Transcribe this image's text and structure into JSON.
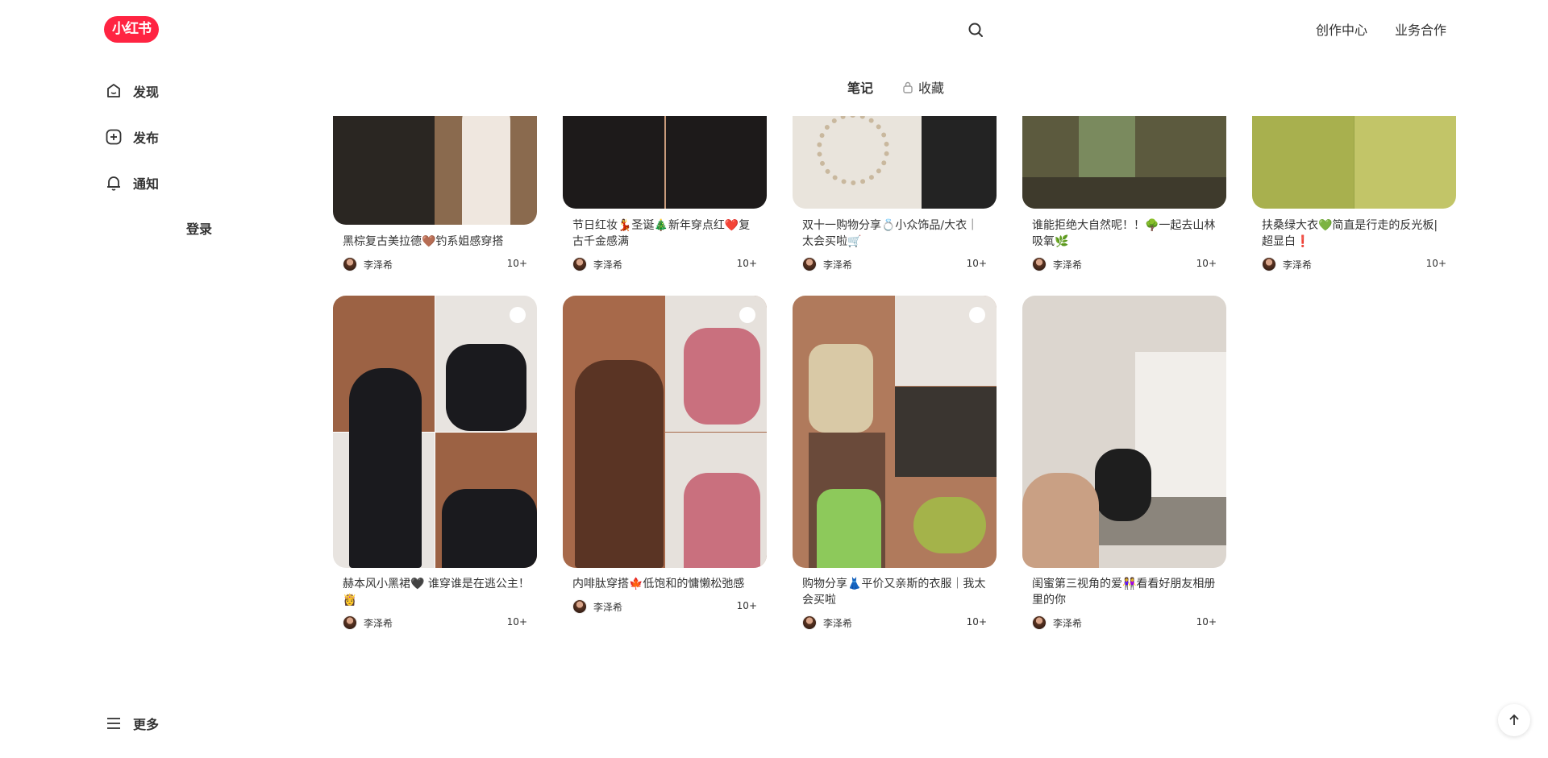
{
  "header": {
    "logo": "小红书",
    "links": [
      "创作中心",
      "业务合作"
    ]
  },
  "sidebar": {
    "items": [
      {
        "label": "发现",
        "icon": "home-icon"
      },
      {
        "label": "发布",
        "icon": "plus-square-icon"
      },
      {
        "label": "通知",
        "icon": "bell-icon"
      }
    ],
    "login": "登录",
    "more": "更多"
  },
  "tabs": [
    {
      "label": "笔记",
      "active": true
    },
    {
      "label": "收藏",
      "active": false,
      "locked": true
    }
  ],
  "notes_row1": [
    {
      "title": "黑棕复古美拉德🤎钓系姐感穿搭",
      "author": "李泽希",
      "likes": "10+",
      "palette": [
        "#2a2622",
        "#efe7df",
        "#8a6a4e"
      ]
    },
    {
      "title": "节日红妆💃圣诞🎄新年穿点红❤️复古千金感满",
      "author": "李泽希",
      "likes": "10+",
      "palette": [
        "#b3202b",
        "#1d1a1a",
        "#c89b7b"
      ]
    },
    {
      "title": "双十一购物分享💍小众饰品/大衣｜太会买啦🛒",
      "author": "李泽希",
      "likes": "10+",
      "palette": [
        "#e9e4dc",
        "#c9b89e",
        "#232323"
      ]
    },
    {
      "title": "谁能拒绝大自然呢！！🌳一起去山林吸氧🌿",
      "author": "李泽希",
      "likes": "10+",
      "palette": [
        "#5c5a3e",
        "#7a8a5e",
        "#3e3a2c"
      ]
    },
    {
      "title": "扶桑绿大衣💚简直是行走的反光板|超显白❗️",
      "author": "李泽希",
      "likes": "10+",
      "palette": [
        "#a8b04e",
        "#9aa548",
        "#c2c568"
      ]
    }
  ],
  "notes_row2": [
    {
      "title": "赫本风小黑裙🖤 谁穿谁是在逃公主！👸",
      "author": "李泽希",
      "likes": "10+",
      "palette": [
        "#9c6244",
        "#1a1a1e",
        "#e8e4e0"
      ]
    },
    {
      "title": "内啡肽穿搭🍁低饱和的慵懒松弛感",
      "author": "李泽希",
      "likes": "10+",
      "palette": [
        "#5a3424",
        "#c9707e",
        "#a7694a"
      ]
    },
    {
      "title": "购物分享👗平价又亲斯的衣服｜我太会买啦",
      "author": "李泽希",
      "likes": "10+",
      "palette": [
        "#d9c9a6",
        "#8dc95b",
        "#3a3530"
      ]
    },
    {
      "title": "闺蜜第三视角的爱👭看看好朋友相册里的你",
      "author": "李泽希",
      "likes": "10+",
      "palette": [
        "#dcd6cf",
        "#f1eeea",
        "#1e1e1e"
      ]
    }
  ]
}
